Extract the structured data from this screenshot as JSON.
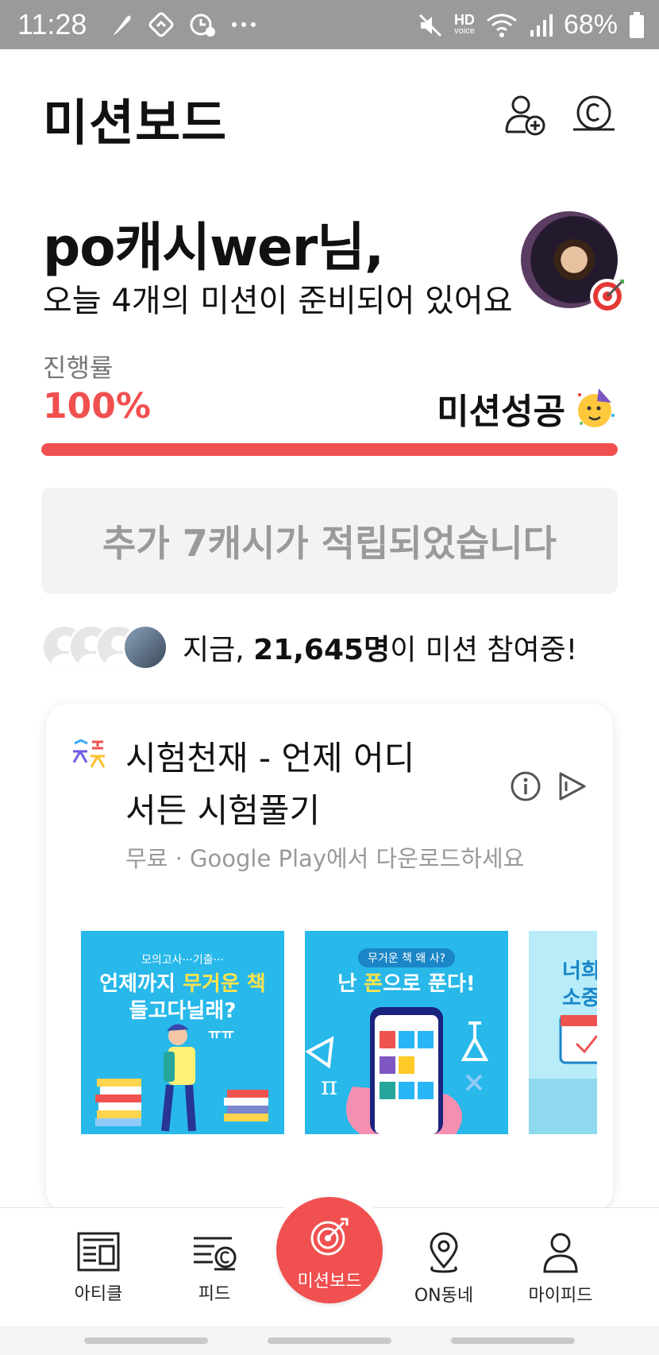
{
  "status_bar": {
    "time": "11:28",
    "battery": "68%",
    "hd_label": "HD",
    "voice_label": "voice"
  },
  "header": {
    "title": "미션보드"
  },
  "greeting": {
    "name": "po캐시wer님,",
    "subtitle": "오늘 4개의 미션이 준비되어 있어요"
  },
  "progress": {
    "label": "진행률",
    "value": "100%",
    "percent": 100,
    "status": "미션성공"
  },
  "reward": {
    "message": "추가 7캐시가 적립되었습니다"
  },
  "participants": {
    "prefix": "지금, ",
    "count": "21,645명",
    "suffix": "이 미션 참여중!"
  },
  "ad": {
    "title": "시험천재 - 언제 어디서든 시험풀기",
    "subtitle": "무료 · Google Play에서 다운로드하세요",
    "banners": [
      {
        "small": "모의고사···기출···",
        "line1a": "언제까지 ",
        "line1b": "무거운 책",
        "line2": "들고다닐래?",
        "deco": "ㅠㅠ"
      },
      {
        "pill": "무거운 책 왜 사?",
        "line1a": "난 ",
        "line1b": "폰",
        "line1c": "으로 푼다!"
      },
      {
        "line1": "너희",
        "line2": "소중"
      }
    ]
  },
  "nav": {
    "items": [
      {
        "label": "아티클"
      },
      {
        "label": "피드"
      },
      {
        "label": "미션보드"
      },
      {
        "label": "ON동네"
      },
      {
        "label": "마이피드"
      }
    ]
  },
  "colors": {
    "accent": "#f0504f",
    "banner": "#28b8ea",
    "status_bar": "#9a9a9a"
  }
}
